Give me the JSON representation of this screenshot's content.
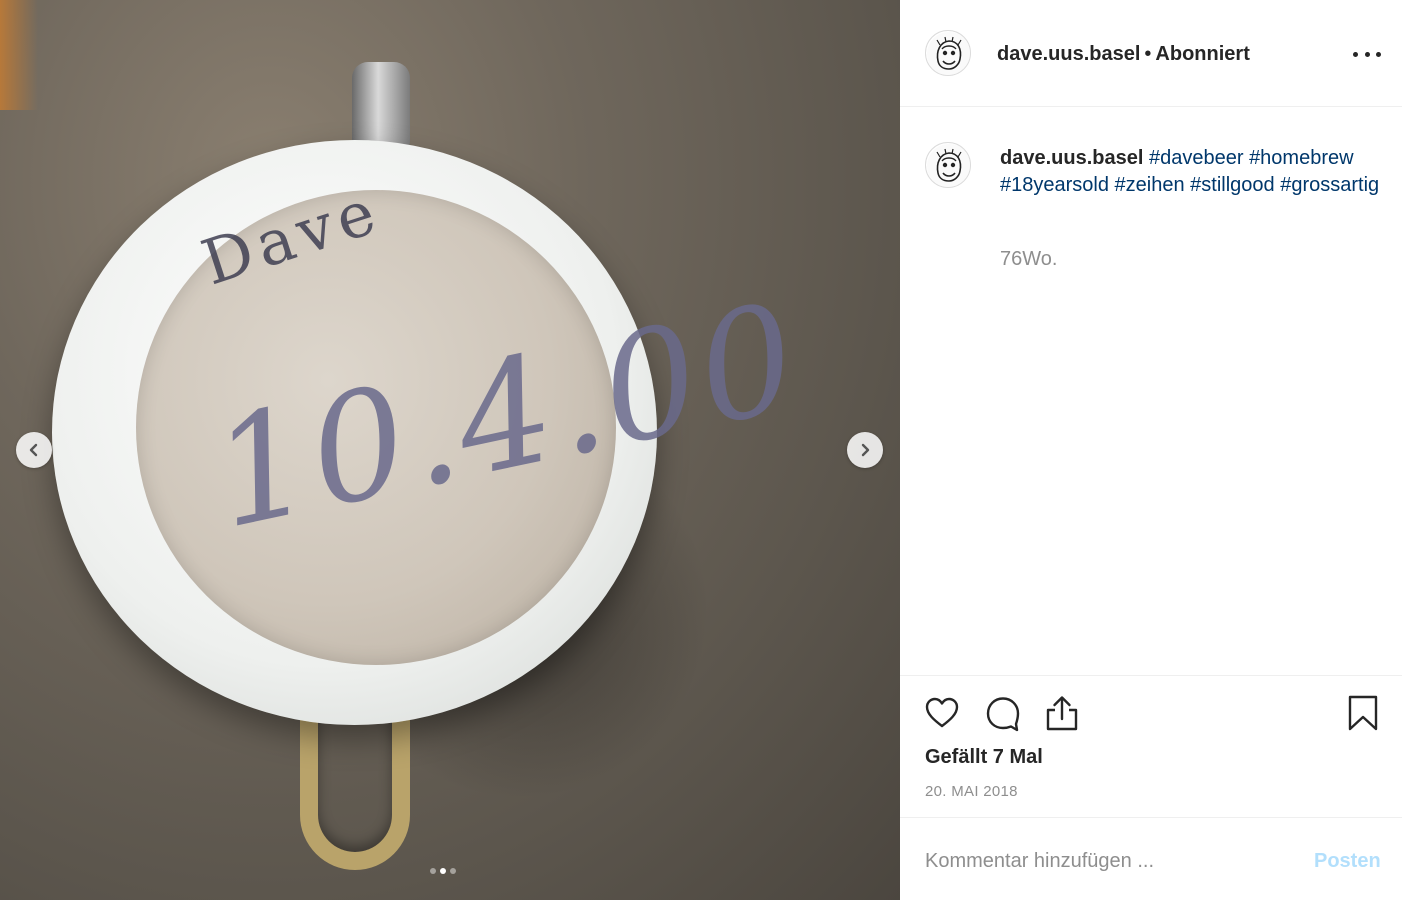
{
  "post": {
    "image": {
      "date_written": "10.4.00",
      "label_top": "Dave",
      "icon_prev": "chevron-left-icon",
      "icon_next": "chevron-right-icon",
      "carousel_dots": 3,
      "carousel_active_index": 1
    }
  },
  "header": {
    "username": "dave.uus.basel",
    "separator": "•",
    "follow_status": "Abonniert",
    "more_icon": "more-horizontal-icon"
  },
  "caption": {
    "username": "dave.uus.basel",
    "hashtags": [
      "#davebeer",
      "#homebrew",
      "#18yearsold",
      "#zeihen",
      "#stillgood",
      "#grossartig"
    ],
    "time_ago": "76Wo."
  },
  "actions": {
    "icons": [
      "heart-icon",
      "comment-icon",
      "share-icon",
      "bookmark-icon"
    ],
    "likes_text": "Gefällt 7 Mal",
    "date_text": "20. MAI 2018"
  },
  "comment_box": {
    "placeholder": "Kommentar hinzufügen ...",
    "post_label": "Posten"
  },
  "colors": {
    "hashtag": "#00376b",
    "muted": "#8e8e8e",
    "post_button_disabled": "#b2dffc",
    "text": "#262626"
  }
}
